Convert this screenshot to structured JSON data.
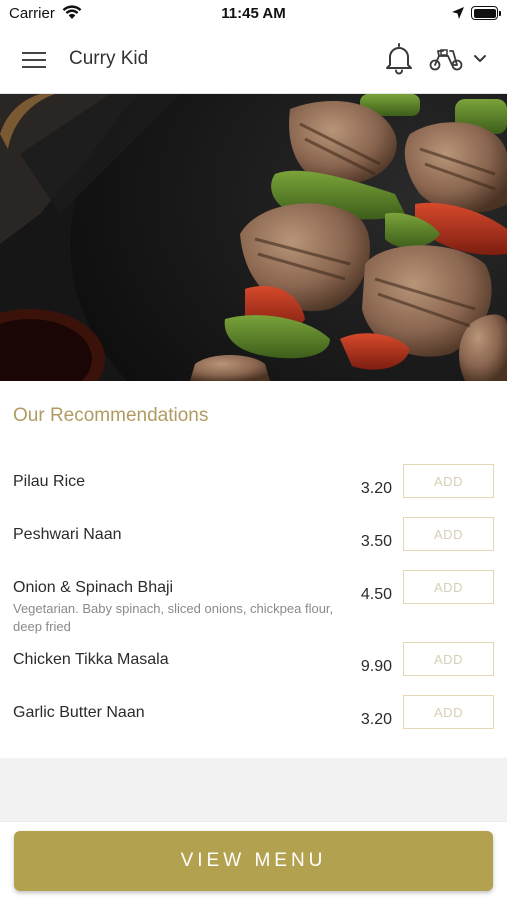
{
  "status_bar": {
    "carrier": "Carrier",
    "time": "11:45 AM",
    "icons": [
      "wifi-icon",
      "location-arrow-icon",
      "battery-icon"
    ]
  },
  "header": {
    "title": "Curry Kid",
    "icons": [
      "hamburger-menu-icon",
      "bell-icon",
      "scooter-delivery-icon",
      "chevron-down-icon"
    ]
  },
  "hero": {
    "image": "grilled-chicken-kebab-skewers-photo"
  },
  "recommendations": {
    "title": "Our Recommendations",
    "add_label": "ADD",
    "items": [
      {
        "name": "Pilau Rice",
        "description": "",
        "price": "3.20"
      },
      {
        "name": "Peshwari Naan",
        "description": "",
        "price": "3.50"
      },
      {
        "name": "Onion & Spinach Bhaji",
        "description": "Vegetarian. Baby spinach, sliced onions, chickpea flour, deep fried",
        "price": "4.50"
      },
      {
        "name": "Chicken Tikka Masala",
        "description": "",
        "price": "9.90"
      },
      {
        "name": "Garlic Butter Naan",
        "description": "",
        "price": "3.20"
      }
    ]
  },
  "footer": {
    "view_menu_label": "VIEW MENU"
  },
  "colors": {
    "accent_gold": "#b2a14e",
    "section_title": "#b09b62",
    "add_border": "#e3d8b6"
  }
}
